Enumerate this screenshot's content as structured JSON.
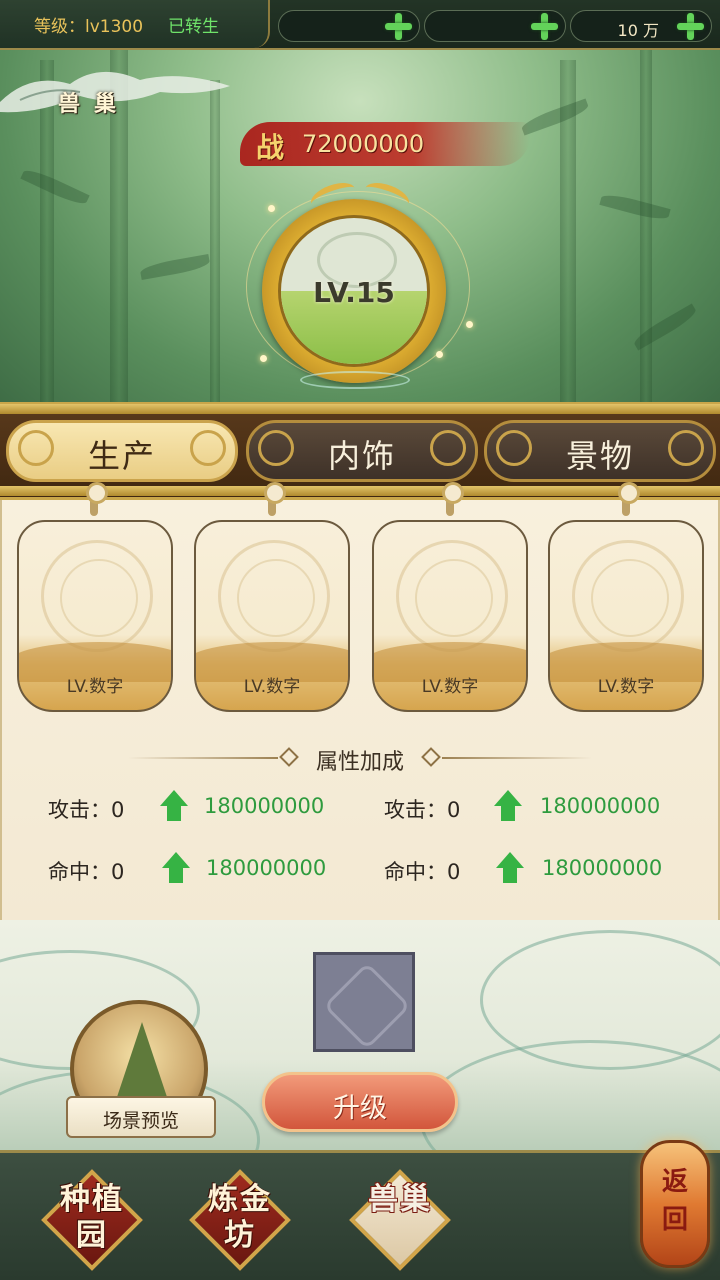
{
  "topbar": {
    "level_label": "等级：lv1300",
    "rebirth_status": "已转生",
    "resources": [
      {
        "value": "",
        "icon": "plus-icon"
      },
      {
        "value": "",
        "icon": "plus-icon"
      },
      {
        "value": "10 万",
        "icon": "plus-icon"
      }
    ]
  },
  "title": "兽巢",
  "power": {
    "icon_char": "战",
    "value": "72000000"
  },
  "orb": {
    "level": "LV.15",
    "progress": 0.5
  },
  "tabs": [
    {
      "label": "生产",
      "active": true
    },
    {
      "label": "内饰",
      "active": false
    },
    {
      "label": "景物",
      "active": false
    }
  ],
  "cards": [
    {
      "level": "LV.数字"
    },
    {
      "level": "LV.数字"
    },
    {
      "level": "LV.数字"
    },
    {
      "level": "LV.数字"
    }
  ],
  "attributes": {
    "title": "属性加成",
    "rows": [
      {
        "label": "攻击：0",
        "bonus": "180000000"
      },
      {
        "label": "攻击：0",
        "bonus": "180000000"
      },
      {
        "label": "命中：0",
        "bonus": "180000000"
      },
      {
        "label": "命中：0",
        "bonus": "180000000"
      }
    ]
  },
  "actions": {
    "preview_label": "场景预览",
    "upgrade_label": "升级"
  },
  "nav": {
    "items": [
      {
        "label": "种植园",
        "active": false
      },
      {
        "label": "炼金坊",
        "active": false
      },
      {
        "label": "兽巢",
        "active": true
      }
    ],
    "back_label": "返回"
  },
  "colors": {
    "accent_gold": "#d9a92f",
    "bonus_green": "#2e9b3e",
    "power_red": "#be2d23"
  }
}
